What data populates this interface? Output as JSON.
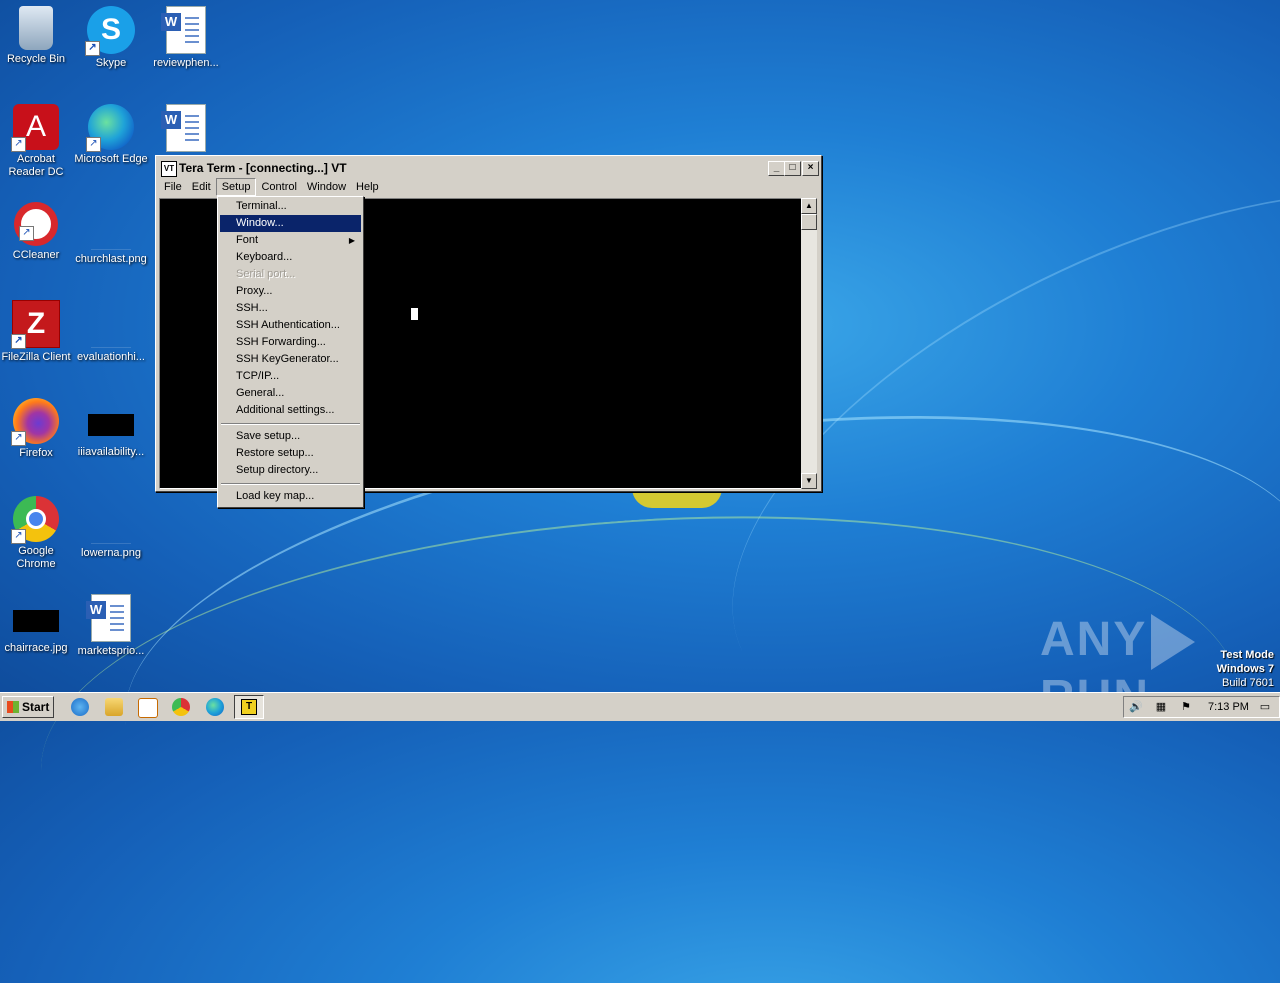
{
  "desktop": {
    "icons": [
      {
        "label": "Recycle Bin"
      },
      {
        "label": "Skype"
      },
      {
        "label": "reviewphen..."
      },
      {
        "label": "Acrobat Reader DC"
      },
      {
        "label": "Microsoft Edge"
      },
      {
        "label": "CCleaner"
      },
      {
        "label": "churchlast.png"
      },
      {
        "label": "FileZilla Client"
      },
      {
        "label": "evaluationhi..."
      },
      {
        "label": "Firefox"
      },
      {
        "label": "iiiavailability..."
      },
      {
        "label": "Google Chrome"
      },
      {
        "label": "lowerna.png"
      },
      {
        "label": "chairrace.jpg"
      },
      {
        "label": "marketsprio..."
      }
    ]
  },
  "window": {
    "title": "Tera Term - [connecting...] VT",
    "icon_text": "VT",
    "controls": {
      "minimize": "_",
      "maximize": "□",
      "close": "×"
    },
    "menubar": [
      "File",
      "Edit",
      "Setup",
      "Control",
      "Window",
      "Help"
    ],
    "active_menu": "Setup"
  },
  "setup_menu": {
    "items": [
      {
        "label": "Terminal..."
      },
      {
        "label": "Window...",
        "highlighted": true
      },
      {
        "label": "Font",
        "submenu": true
      },
      {
        "label": "Keyboard..."
      },
      {
        "label": "Serial port...",
        "disabled": true
      },
      {
        "label": "Proxy..."
      },
      {
        "label": "SSH..."
      },
      {
        "label": "SSH Authentication..."
      },
      {
        "label": "SSH Forwarding..."
      },
      {
        "label": "SSH KeyGenerator..."
      },
      {
        "label": "TCP/IP..."
      },
      {
        "label": "General..."
      },
      {
        "label": "Additional settings..."
      },
      {
        "label": "Save setup..."
      },
      {
        "label": "Restore setup..."
      },
      {
        "label": "Setup directory..."
      },
      {
        "label": "Load key map..."
      }
    ]
  },
  "watermark": {
    "left": "ANY",
    "right": "RUN"
  },
  "os_info": {
    "line1": "Test Mode",
    "line2": "Windows 7",
    "line3": "Build 7601"
  },
  "taskbar": {
    "start_label": "Start",
    "clock": "7:13 PM"
  },
  "colors": {
    "highlight": "#0a246a",
    "desktop": "#1f7fd4",
    "face": "#d4d0c8"
  }
}
